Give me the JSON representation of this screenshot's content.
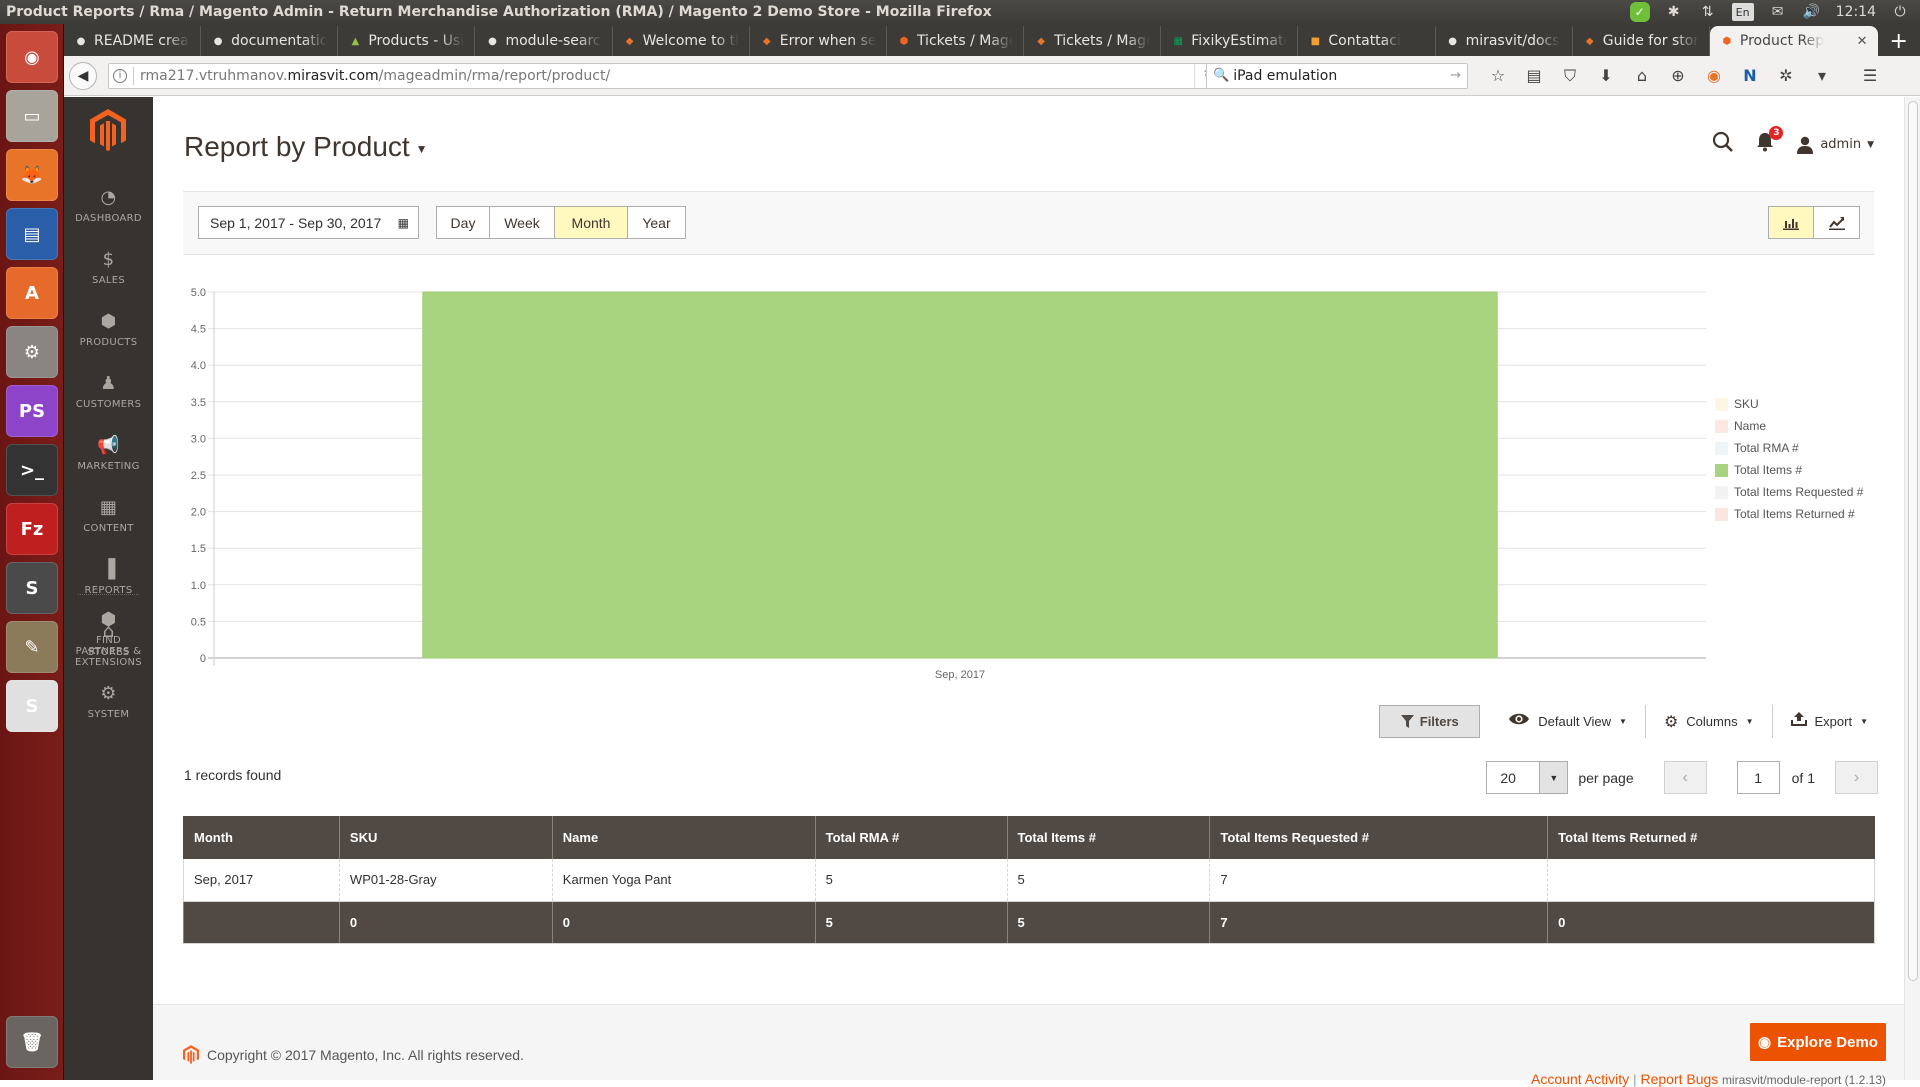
{
  "os": {
    "window_title": "Product Reports / Rma / Magento Admin - Return Merchandise Authorization (RMA) / Magento 2 Demo Store - Mozilla Firefox",
    "keyboard_layout": "En",
    "clock": "12:14",
    "launcher_apps": [
      {
        "name": "ubuntu-dash",
        "glyph": "◉",
        "color": "#c94b3b"
      },
      {
        "name": "files",
        "glyph": "▭",
        "color": "#a8a49c"
      },
      {
        "name": "firefox",
        "glyph": "🦊",
        "color": "#e8742a"
      },
      {
        "name": "libreoffice-impress",
        "glyph": "▤",
        "color": "#2a5ea8"
      },
      {
        "name": "software-center",
        "glyph": "A",
        "color": "#e66a2c"
      },
      {
        "name": "system-settings",
        "glyph": "⚙",
        "color": "#8a8580"
      },
      {
        "name": "phpstorm",
        "glyph": "PS",
        "color": "#8d44c8"
      },
      {
        "name": "terminal",
        "glyph": ">_",
        "color": "#333"
      },
      {
        "name": "filezilla",
        "glyph": "Fz",
        "color": "#bf1f1f"
      },
      {
        "name": "sublime-text",
        "glyph": "S",
        "color": "#4a4a4a"
      },
      {
        "name": "gimp",
        "glyph": "✎",
        "color": "#8b7a5a"
      },
      {
        "name": "slack",
        "glyph": "S",
        "color": "#e0e0e0"
      }
    ]
  },
  "browser": {
    "tabs": [
      {
        "label": "README creat",
        "icon": "github",
        "icon_color": "#e8e6e1"
      },
      {
        "label": "documentatio",
        "icon": "github",
        "icon_color": "#e8e6e1"
      },
      {
        "label": "Products - Usi",
        "icon": "shopify",
        "icon_color": "#95bf47"
      },
      {
        "label": "module-search",
        "icon": "github",
        "icon_color": "#e8e6e1"
      },
      {
        "label": "Welcome to th",
        "icon": "jira",
        "icon_color": "#e8742a"
      },
      {
        "label": "Error when ser",
        "icon": "jira",
        "icon_color": "#e8742a"
      },
      {
        "label": "Tickets / Mage",
        "icon": "magento",
        "icon_color": "#f26322"
      },
      {
        "label": "Tickets / Mage",
        "icon": "jira",
        "icon_color": "#e8742a"
      },
      {
        "label": "FixikyEstimate",
        "icon": "sheets",
        "icon_color": "#0f9d58"
      },
      {
        "label": "Contattaci",
        "icon": "site",
        "icon_color": "#f0a030"
      },
      {
        "label": "mirasvit/docs",
        "icon": "github",
        "icon_color": "#e8e6e1"
      },
      {
        "label": "Guide for stor",
        "icon": "jira",
        "icon_color": "#e8742a"
      },
      {
        "label": "Product Rep",
        "icon": "magento",
        "icon_color": "#f26322",
        "active": true
      }
    ],
    "url_prefix": "rma217.vtruhmanov.",
    "url_host": "mirasvit.com",
    "url_path": "/mageadmin/rma/report/product/",
    "search_value": "iPad emulation"
  },
  "sidebar": {
    "items": [
      {
        "label": "DASHBOARD",
        "icon": "dashboard-icon",
        "glyph": "◔"
      },
      {
        "label": "SALES",
        "icon": "dollar-icon",
        "glyph": "$"
      },
      {
        "label": "PRODUCTS",
        "icon": "box-icon",
        "glyph": "⬢"
      },
      {
        "label": "CUSTOMERS",
        "icon": "person-icon",
        "glyph": "♟"
      },
      {
        "label": "MARKETING",
        "icon": "megaphone-icon",
        "glyph": "📢"
      },
      {
        "label": "CONTENT",
        "icon": "layout-icon",
        "glyph": "▦"
      },
      {
        "label": "REPORTS",
        "icon": "bar-chart-icon",
        "glyph": "▐"
      },
      {
        "label": "STORES",
        "icon": "store-icon",
        "glyph": "⌂"
      },
      {
        "label": "SYSTEM",
        "icon": "gear-icon",
        "glyph": "⚙"
      }
    ],
    "partners": {
      "line1": "FIND",
      "line2": "PARTNERS &",
      "line3": "EXTENSIONS"
    }
  },
  "header": {
    "title": "Report by Product",
    "notifications_count": "3",
    "user": "admin"
  },
  "toolbar": {
    "date_range": "Sep 1, 2017 - Sep 30, 2017",
    "intervals": [
      {
        "label": "Day",
        "active": false
      },
      {
        "label": "Week",
        "active": false
      },
      {
        "label": "Month",
        "active": true
      },
      {
        "label": "Year",
        "active": false
      }
    ],
    "chart_types": [
      {
        "name": "column",
        "active": true
      },
      {
        "name": "line",
        "active": false
      }
    ]
  },
  "chart_data": {
    "type": "bar",
    "title": "",
    "xlabel": "",
    "ylabel": "",
    "categories": [
      "Sep, 2017"
    ],
    "ylim": [
      0,
      5
    ],
    "yticks": [
      "0",
      "0.5",
      "1.0",
      "1.5",
      "2.0",
      "2.5",
      "3.0",
      "3.5",
      "4.0",
      "4.5",
      "5.0"
    ],
    "grid": true,
    "legend_position": "right",
    "series": [
      {
        "name": "SKU",
        "color": "#fdf6e0",
        "values": [
          null
        ],
        "visible": false
      },
      {
        "name": "Name",
        "color": "#fde7e3",
        "values": [
          null
        ],
        "visible": false
      },
      {
        "name": "Total RMA #",
        "color": "#eef4f8",
        "values": [
          5
        ],
        "visible": false
      },
      {
        "name": "Total Items #",
        "color": "#a8d47f",
        "values": [
          5
        ],
        "visible": true
      },
      {
        "name": "Total Items Requested #",
        "color": "#f2f2f2",
        "values": [
          7
        ],
        "visible": false
      },
      {
        "name": "Total Items Returned #",
        "color": "#fbe5e0",
        "values": [
          0
        ],
        "visible": false
      }
    ]
  },
  "grid_actions": {
    "filters": "Filters",
    "view": "Default View",
    "columns": "Columns",
    "export": "Export"
  },
  "records": {
    "found_text": "1 records found",
    "per_page": "20",
    "per_page_label": "per page",
    "current_page": "1",
    "of_pages": "of 1"
  },
  "table": {
    "columns": [
      "Month",
      "SKU",
      "Name",
      "Total RMA #",
      "Total Items #",
      "Total Items Requested #",
      "Total Items Returned #"
    ],
    "rows": [
      [
        "Sep, 2017",
        "WP01-28-Gray",
        "Karmen Yoga Pant",
        "5",
        "5",
        "7",
        ""
      ]
    ],
    "totals": [
      "",
      "0",
      "0",
      "5",
      "5",
      "7",
      "0"
    ]
  },
  "footer": {
    "copyright": "Copyright © 2017 Magento, Inc. All rights reserved.",
    "explore_demo": "Explore Demo",
    "account_activity": "Account Activity",
    "report_bugs": "Report Bugs",
    "version": "mirasvit/module-report (1.2.13)"
  },
  "colors": {
    "magento_orange": "#eb5202",
    "sidebar_bg": "#373330",
    "table_header_bg": "#514943",
    "active_toggle": "#fff9c0",
    "bar_fill": "#a8d47f"
  }
}
